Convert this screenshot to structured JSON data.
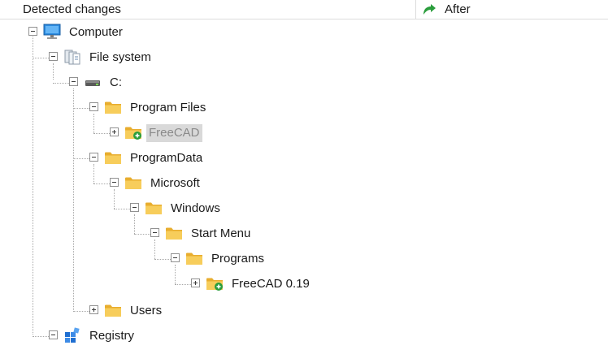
{
  "header": {
    "detected_changes": "Detected changes",
    "after": "After"
  },
  "colors": {
    "folder": "#f2c14e",
    "added_badge": "#2a9d3c",
    "computer": "#2b8be0",
    "registry": "#1f6fd1",
    "selection": "#d9d9d9"
  },
  "tree": {
    "computer": "Computer",
    "file_system": "File system",
    "drive_c": "C:",
    "program_files": "Program Files",
    "freecad": "FreeCAD",
    "programdata": "ProgramData",
    "microsoft": "Microsoft",
    "windows": "Windows",
    "start_menu": "Start Menu",
    "programs": "Programs",
    "freecad_019": "FreeCAD 0.19",
    "users": "Users",
    "registry": "Registry"
  }
}
